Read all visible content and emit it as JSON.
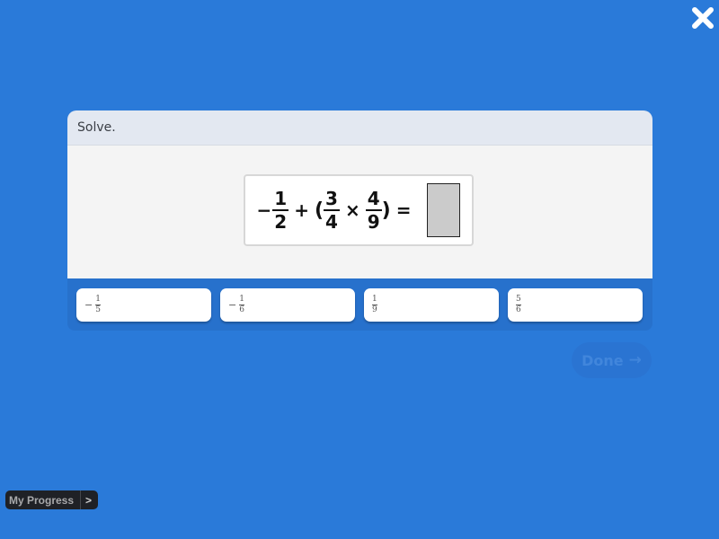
{
  "close": {
    "icon": "close-icon"
  },
  "question": {
    "prompt": "Solve.",
    "equation": {
      "term1": {
        "sign": "−",
        "numerator": "1",
        "denominator": "2"
      },
      "op1": "+",
      "open_paren": "(",
      "term2": {
        "numerator": "3",
        "denominator": "4"
      },
      "op2": "×",
      "term3": {
        "numerator": "4",
        "denominator": "9"
      },
      "close_paren": ")",
      "equals": "="
    }
  },
  "choices": [
    {
      "sign": "−",
      "numerator": "1",
      "denominator": "5"
    },
    {
      "sign": "−",
      "numerator": "1",
      "denominator": "6"
    },
    {
      "sign": "",
      "numerator": "1",
      "denominator": "9"
    },
    {
      "sign": "",
      "numerator": "5",
      "denominator": "6"
    }
  ],
  "done": {
    "label": "Done",
    "arrow": "→",
    "enabled": false
  },
  "progress": {
    "label": "My Progress",
    "chevron": ">"
  },
  "colors": {
    "background": "#2a7ad9",
    "tray": "#2771cc",
    "header": "#e3e8f1",
    "answer_slot": "#cbcbcb"
  }
}
